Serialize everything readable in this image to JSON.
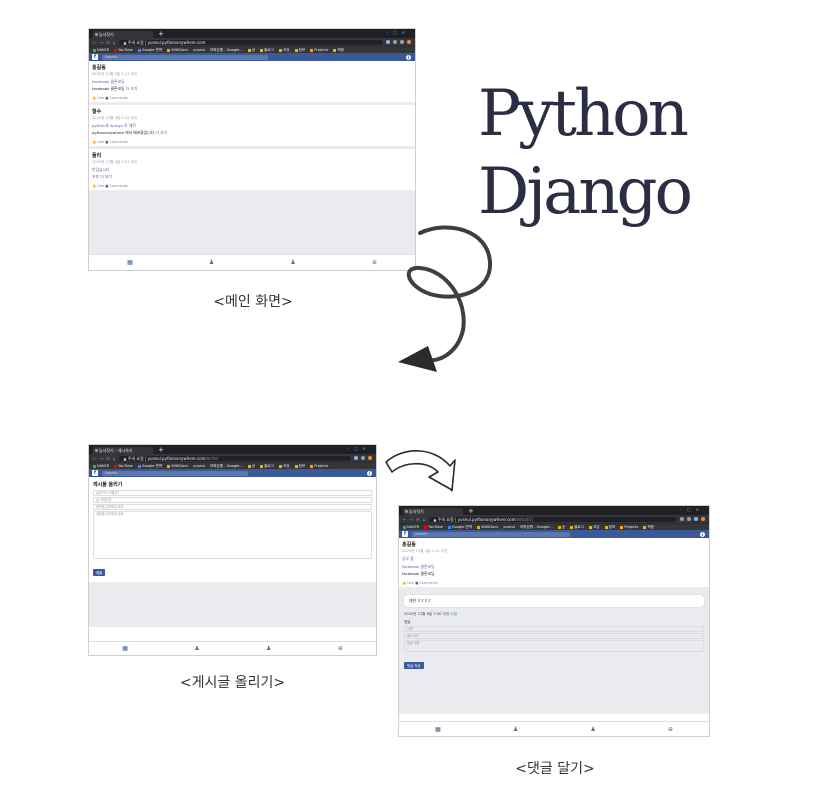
{
  "hero": {
    "line1": "Python",
    "line2": "Django"
  },
  "captions": {
    "main": "<메인 화면>",
    "write": "<게시글 올리기>",
    "comment": "<댓글 달기>"
  },
  "browser": {
    "tab_main": "농사짓기",
    "tab_write": "농사짓기 - 게시하기",
    "tab_comment": "농사짓기",
    "url_host": "yuseul.pythonanywhere.com",
    "url_write_path": "/write/",
    "url_comment_path": "/detail/1/",
    "security_label": "주의 요함",
    "bookmarks": [
      "NAVER",
      "YouTube",
      "Google 번역",
      "WIKIDocs",
      "yuseul",
      "저축은행 - Google...",
      "공",
      "블로그",
      "코딩",
      "정보",
      "Projects",
      "책용"
    ]
  },
  "app": {
    "search_placeholder": "Search",
    "logo_glyph": "f",
    "info_glyph": "i"
  },
  "main_posts": [
    {
      "name": "홍길동",
      "date": "2020년 12월 3일 2:11 오전",
      "title": "facebook 클론코딩",
      "body": "facebook 클론코딩",
      "more": "더 보기",
      "like": "Like",
      "comments": "Comments"
    },
    {
      "name": "철수",
      "date": "2020년 12월 3일 2:12 오전",
      "title": "python과 django 로 제작",
      "body": "pythonanywhere 에서 배포중입니다",
      "more": "더 보기",
      "like": "Like",
      "comments": "Comments"
    },
    {
      "name": "둘리",
      "date": "2020년 12월 4일 7:01 오전",
      "title": "반갑습니다",
      "body": "ㅎㅎ",
      "more": "더 보기",
      "like": "Like",
      "comments": "Comments"
    }
  ],
  "write_form": {
    "heading": "게시물 올리기",
    "author_placeholder": "글쓴이의 이름은?",
    "pass_placeholder": "글 비밀번호",
    "title_placeholder": "제목을 입력해주세요",
    "body_placeholder": "내용을 입력해주세요",
    "submit": "제출"
  },
  "comment_view": {
    "name": "홍길동",
    "date": "2020년 12월 3일 2:11 오전",
    "title": "공부 중",
    "body": "facebook 클론코딩",
    "body2": "facebook 클론코딩",
    "like": "Like",
    "comments": "Comments",
    "comment_text": "재현 ㅎㅎㅎㅎ",
    "comment_date": "2020년 12월 8일 7:30 오전",
    "comment_edit": "수정",
    "form_label": "댓글",
    "author_placeholder": "이름",
    "pass_placeholder": "패스워드",
    "body_placeholder": "댓글 내용",
    "submit": "댓글 작성"
  },
  "bottom_nav_icons": [
    "home-icon",
    "user-icon",
    "user-icon",
    "globe-icon"
  ]
}
